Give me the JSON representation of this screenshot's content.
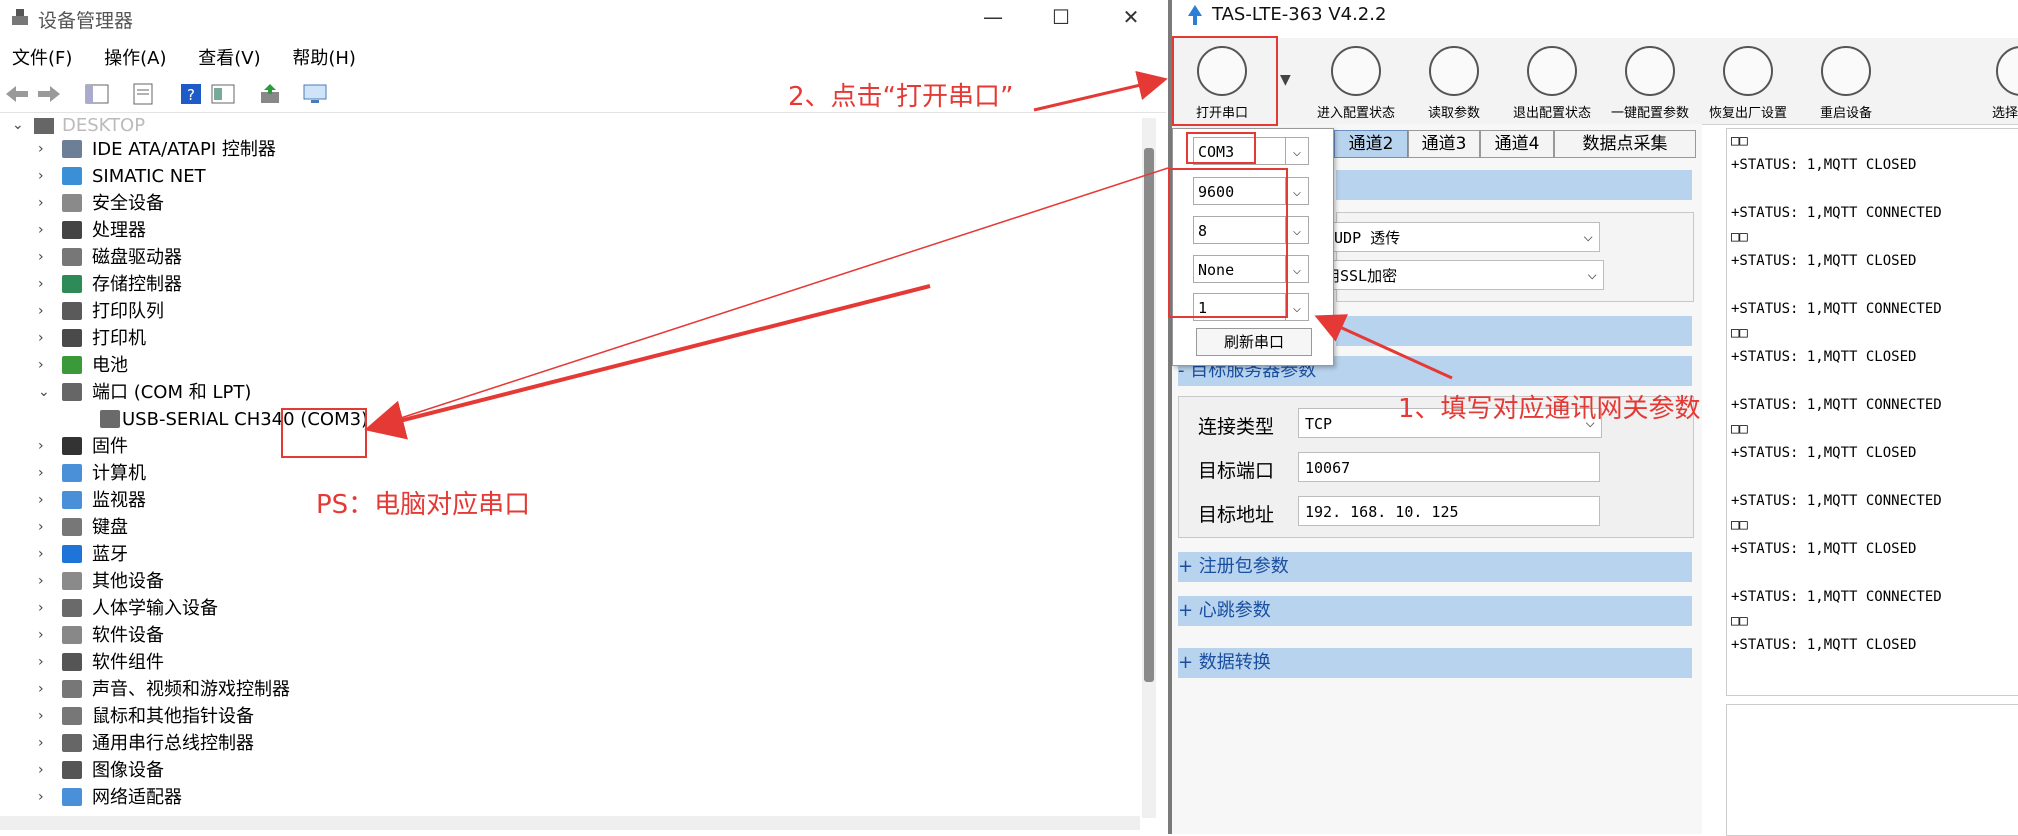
{
  "device_manager": {
    "title": "设备管理器",
    "menu": [
      "文件(F)",
      "操作(A)",
      "查看(V)",
      "帮助(H)"
    ],
    "root_label": "DESKTOP",
    "tree": [
      {
        "label": "IDE ATA/ATAPI 控制器",
        "expanded": false,
        "icon": "ide-controller-icon"
      },
      {
        "label": "SIMATIC NET",
        "expanded": false,
        "icon": "network-icon"
      },
      {
        "label": "安全设备",
        "expanded": false,
        "icon": "security-device-icon"
      },
      {
        "label": "处理器",
        "expanded": false,
        "icon": "processor-icon"
      },
      {
        "label": "磁盘驱动器",
        "expanded": false,
        "icon": "disk-drive-icon"
      },
      {
        "label": "存储控制器",
        "expanded": false,
        "icon": "storage-controller-icon"
      },
      {
        "label": "打印队列",
        "expanded": false,
        "icon": "print-queue-icon"
      },
      {
        "label": "打印机",
        "expanded": false,
        "icon": "printer-icon"
      },
      {
        "label": "电池",
        "expanded": false,
        "icon": "battery-icon"
      },
      {
        "label": "端口 (COM 和 LPT)",
        "expanded": true,
        "icon": "port-icon"
      },
      {
        "label": "USB-SERIAL CH340 (COM3)",
        "child": true,
        "icon": "serial-port-icon"
      },
      {
        "label": "固件",
        "expanded": false,
        "icon": "firmware-icon"
      },
      {
        "label": "计算机",
        "expanded": false,
        "icon": "computer-icon"
      },
      {
        "label": "监视器",
        "expanded": false,
        "icon": "monitor-icon"
      },
      {
        "label": "键盘",
        "expanded": false,
        "icon": "keyboard-icon"
      },
      {
        "label": "蓝牙",
        "expanded": false,
        "icon": "bluetooth-icon"
      },
      {
        "label": "其他设备",
        "expanded": false,
        "icon": "other-devices-icon"
      },
      {
        "label": "人体学输入设备",
        "expanded": false,
        "icon": "hid-icon"
      },
      {
        "label": "软件设备",
        "expanded": false,
        "icon": "software-device-icon"
      },
      {
        "label": "软件组件",
        "expanded": false,
        "icon": "software-component-icon"
      },
      {
        "label": "声音、视频和游戏控制器",
        "expanded": false,
        "icon": "audio-icon"
      },
      {
        "label": "鼠标和其他指针设备",
        "expanded": false,
        "icon": "mouse-icon"
      },
      {
        "label": "通用串行总线控制器",
        "expanded": false,
        "icon": "usb-icon"
      },
      {
        "label": "图像设备",
        "expanded": false,
        "icon": "camera-icon"
      },
      {
        "label": "网络适配器",
        "expanded": false,
        "icon": "network-adapter-icon"
      }
    ]
  },
  "tas": {
    "title": "TAS-LTE-363 V4.2.2",
    "toolbar": [
      "打开串口",
      "进入配置状态",
      "读取参数",
      "退出配置状态",
      "一键配置参数",
      "恢复出厂设置",
      "重启设备",
      "选择"
    ],
    "serial": {
      "port": "COM3",
      "baud": "9600",
      "data_bits": "8",
      "parity": "None",
      "stop_bits": "1",
      "refresh": "刷新串口"
    },
    "tabs": [
      "通道2",
      "通道3",
      "通道4",
      "数据点采集"
    ],
    "mode_select": "/UDP 透传",
    "ssl_select": "用SSL加密",
    "sections": {
      "target": "- 目标服务器参数",
      "register": "+ 注册包参数",
      "heartbeat": "+ 心跳参数",
      "convert": "+ 数据转换"
    },
    "fields": {
      "conn_type_label": "连接类型",
      "conn_type": "TCP",
      "port_label": "目标端口",
      "port": "10067",
      "addr_label": "目标地址",
      "addr": "192. 168. 10. 125"
    },
    "log": [
      "□□",
      "+STATUS: 1,MQTT CLOSED",
      "",
      "+STATUS: 1,MQTT CONNECTED",
      "□□",
      "+STATUS: 1,MQTT CLOSED",
      "",
      "+STATUS: 1,MQTT CONNECTED",
      "□□",
      "+STATUS: 1,MQTT CLOSED",
      "",
      "+STATUS: 1,MQTT CONNECTED",
      "□□",
      "+STATUS: 1,MQTT CLOSED",
      "",
      "+STATUS: 1,MQTT CONNECTED",
      "□□",
      "+STATUS: 1,MQTT CLOSED",
      "",
      "+STATUS: 1,MQTT CONNECTED",
      "□□",
      "+STATUS: 1,MQTT CLOSED"
    ]
  },
  "annotations": {
    "step2": "2、点击“打开串口”",
    "step1": "1、填写对应通讯网关参数",
    "ps": "PS：电脑对应串口"
  },
  "colors": {
    "annotation": "#e53935",
    "section_bg": "#b8d3ee",
    "section_text": "#1a4fa0"
  }
}
